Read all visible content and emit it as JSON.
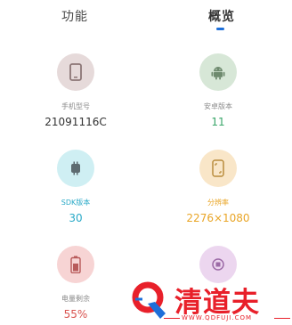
{
  "tabs": [
    {
      "label": "功能",
      "active": false
    },
    {
      "label": "概览",
      "active": true
    }
  ],
  "colors": {
    "tab_indicator": "#1e6fd9",
    "watermark": "#e8202a"
  },
  "items": [
    {
      "label": "手机型号",
      "value": "21091116C",
      "icon": "phone-icon",
      "value_color": "#333333"
    },
    {
      "label": "安卓版本",
      "value": "11",
      "icon": "android-icon",
      "value_color": "#3aa66a"
    },
    {
      "label": "SDK版本",
      "value": "30",
      "icon": "sdk-icon",
      "value_color": "#29a9c7"
    },
    {
      "label": "分辨率",
      "value": "2276×1080",
      "icon": "screen-icon",
      "value_color": "#e9a526"
    },
    {
      "label": "电量剩余",
      "value": "55%",
      "icon": "battery-icon",
      "value_color": "#d9534f"
    },
    {
      "label": "",
      "value": "",
      "icon": "cpu-icon",
      "value_color": "#b25bc0"
    }
  ],
  "watermark": {
    "text": "清道夫",
    "url": "WWW.QDFUJI.COM"
  }
}
